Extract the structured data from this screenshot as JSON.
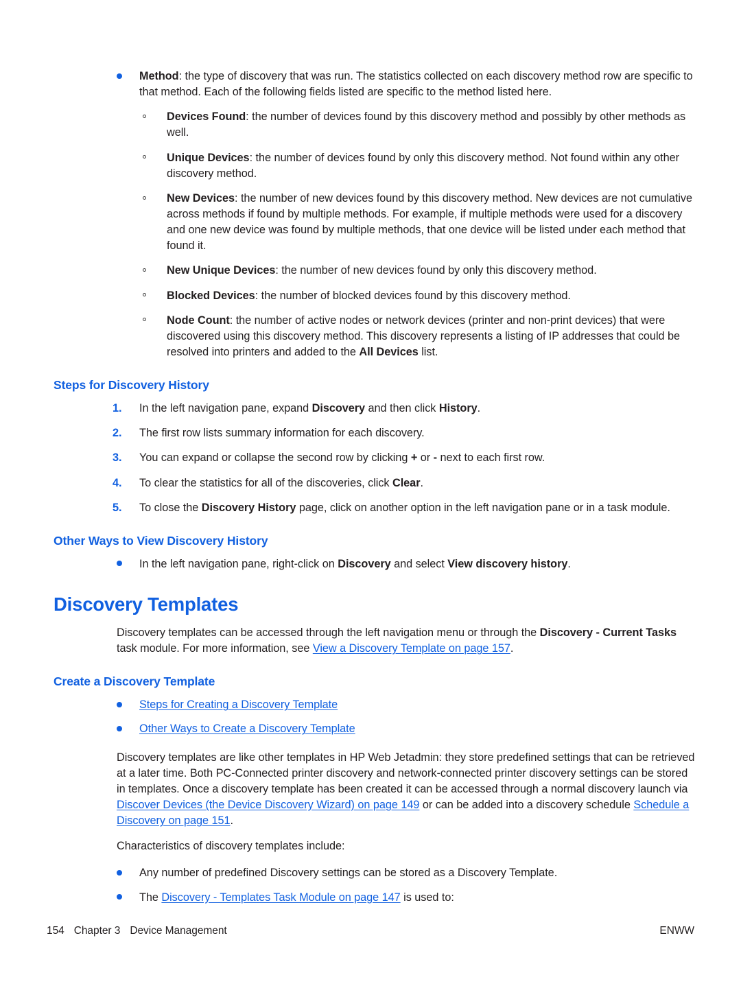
{
  "document": {
    "page_number": "154",
    "chapter_label": "Chapter 3",
    "chapter_title": "Device Management",
    "locale_code": "ENWW",
    "accent_color": "#1160e0",
    "text_color": "#231f20"
  },
  "method_bullet": {
    "term": "Method",
    "text": ": the type of discovery that was run. The statistics collected on each discovery method row are specific to that method. Each of the following fields listed are specific to the method listed here."
  },
  "field_items": [
    {
      "term": "Devices Found",
      "text": ": the number of devices found by this discovery method and possibly by other methods as well."
    },
    {
      "term": "Unique Devices",
      "text": ": the number of devices found by only this discovery method. Not found within any other discovery method."
    },
    {
      "term": "New Devices",
      "text": ": the number of new devices found by this discovery method. New devices are not cumulative across methods if found by multiple methods. For example, if multiple methods were used for a discovery and one new device was found by multiple methods, that one device will be listed under each method that found it."
    },
    {
      "term": "New Unique Devices",
      "text": ": the number of new devices found by only this discovery method."
    },
    {
      "term": "Blocked Devices",
      "text": ": the number of blocked devices found by this discovery method."
    }
  ],
  "node_count_item": {
    "term": "Node Count",
    "text_part1": ": the number of active nodes or network devices (printer and non-print devices) that were discovered using this discovery method. This discovery represents a listing of IP addresses that could be resolved into printers and added to the ",
    "bold_ref": "All Devices",
    "text_part2": " list."
  },
  "steps_section": {
    "heading": "Steps for Discovery History",
    "steps": [
      {
        "number": "1.",
        "part1": "In the left navigation pane, expand ",
        "bold1": "Discovery",
        "part2": " and then click ",
        "bold2": "History",
        "part3": "."
      },
      {
        "number": "2.",
        "part1": "The first row lists summary information for each discovery.",
        "bold1": "",
        "part2": "",
        "bold2": "",
        "part3": ""
      },
      {
        "number": "3.",
        "part1": "You can expand or collapse the second row by clicking ",
        "bold1": "+",
        "part2": " or ",
        "bold2": "-",
        "part3": " next to each first row."
      },
      {
        "number": "4.",
        "part1": "To clear the statistics for all of the discoveries, click ",
        "bold1": "Clear",
        "part2": ".",
        "bold2": "",
        "part3": ""
      },
      {
        "number": "5.",
        "part1": "To close the ",
        "bold1": "Discovery History",
        "part2": " page, click on another option in the left navigation pane or in a task module.",
        "bold2": "",
        "part3": ""
      }
    ]
  },
  "other_ways_section": {
    "heading": "Other Ways to View Discovery History",
    "bullet": {
      "part1": "In the left navigation pane, right-click on ",
      "bold1": "Discovery",
      "part2": " and select ",
      "bold2": "View discovery history",
      "part3": "."
    }
  },
  "discovery_templates": {
    "heading": "Discovery Templates",
    "intro_part1": "Discovery templates can be accessed through the left navigation menu or through the ",
    "intro_bold": "Discovery - Current Tasks",
    "intro_part2": " task module. For more information, see ",
    "intro_link": "View a Discovery Template on page 157",
    "intro_part3": "."
  },
  "create_template": {
    "heading": "Create a Discovery Template",
    "links": [
      "Steps for Creating a Discovery Template",
      "Other Ways to Create a Discovery Template"
    ],
    "paragraph_part1": "Discovery templates are like other templates in HP Web Jetadmin: they store predefined settings that can be retrieved at a later time. Both PC-Connected printer discovery and network-connected printer discovery settings can be stored in templates. Once a discovery template has been created it can be accessed through a normal discovery launch via ",
    "paragraph_link1": "Discover Devices (the Device Discovery Wizard) on page 149",
    "paragraph_part2": " or can be added into a discovery schedule ",
    "paragraph_link2": "Schedule a Discovery on page 151",
    "paragraph_part3": ".",
    "characteristics_lead": "Characteristics of discovery templates include:",
    "characteristic_1": "Any number of predefined Discovery settings can be stored as a Discovery Template.",
    "characteristic_2_part1": "The ",
    "characteristic_2_link": "Discovery - Templates Task Module on page 147",
    "characteristic_2_part2": " is used to:"
  }
}
